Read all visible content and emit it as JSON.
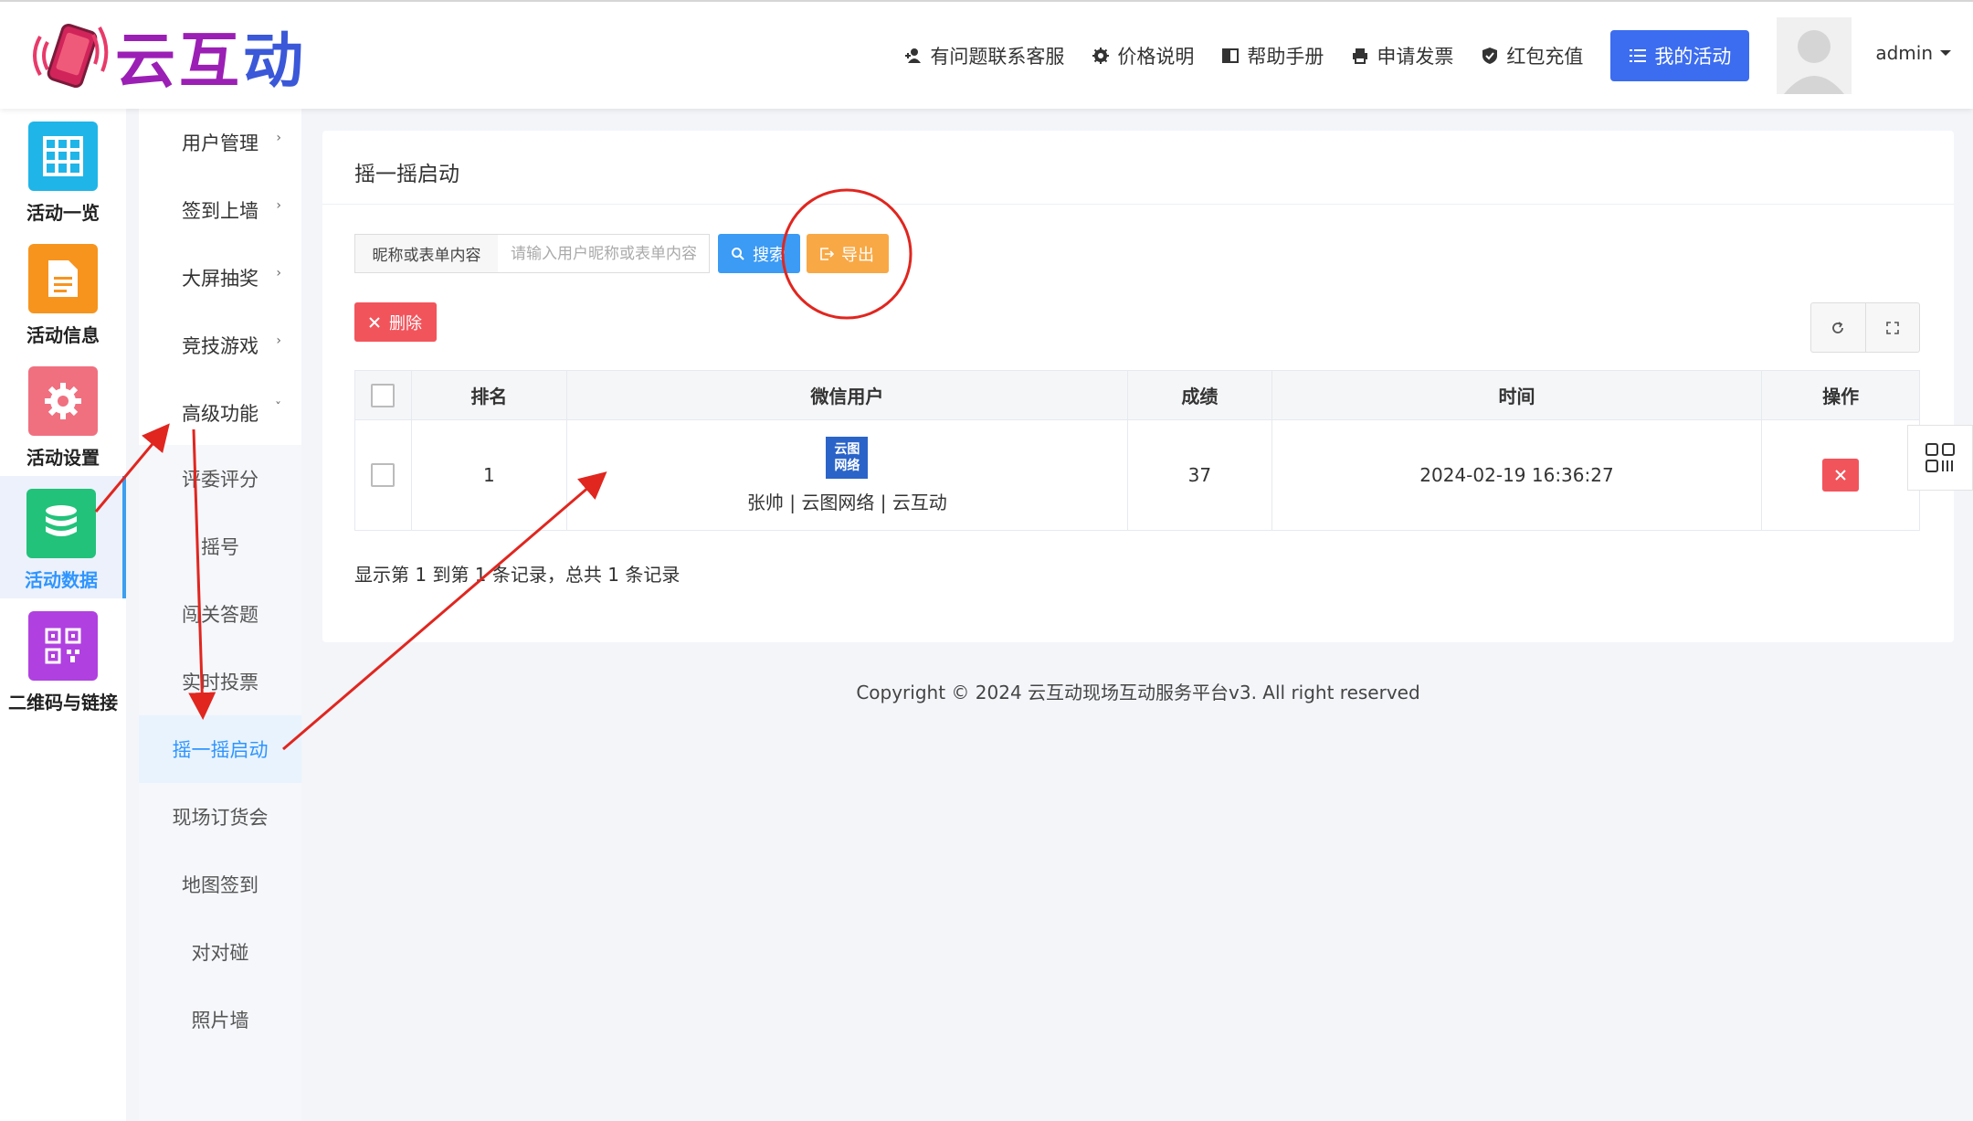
{
  "header": {
    "logo_text_main": "云互",
    "logo_text_accent": "动",
    "links": [
      "有问题联系客服",
      "价格说明",
      "帮助手册",
      "申请发票",
      "红包充值"
    ],
    "my_activity": "我的活动",
    "user": "admin"
  },
  "sidebar": {
    "items": [
      {
        "label": "活动一览",
        "icon": "grid-icon",
        "color": "#1fb5e8"
      },
      {
        "label": "活动信息",
        "icon": "document-icon",
        "color": "#f7941d"
      },
      {
        "label": "活动设置",
        "icon": "gear-icon",
        "color": "#f07080"
      },
      {
        "label": "活动数据",
        "icon": "database-icon",
        "color": "#22c27a"
      },
      {
        "label": "二维码与链接",
        "icon": "qrcode-icon",
        "color": "#b040e0"
      }
    ]
  },
  "submenu": {
    "items": [
      "用户管理",
      "签到上墙",
      "大屏抽奖",
      "竞技游戏",
      "高级功能"
    ],
    "children": [
      "评委评分",
      "摇号",
      "闯关答题",
      "实时投票",
      "摇一摇启动",
      "现场订货会",
      "地图签到",
      "对对碰",
      "照片墙"
    ]
  },
  "panel": {
    "title": "摇一摇启动",
    "search_label": "昵称或表单内容",
    "search_placeholder": "请输入用户昵称或表单内容",
    "search_btn": "搜索",
    "export_btn": "导出",
    "delete_btn": "删除",
    "table": {
      "headers": [
        "排名",
        "微信用户",
        "成绩",
        "时间",
        "操作"
      ],
      "rows": [
        {
          "rank": "1",
          "logo_top": "云图",
          "logo_bottom": "网络",
          "user": "张帅 | 云图网络 | 云互动",
          "score": "37",
          "time": "2024-02-19 16:36:27"
        }
      ]
    },
    "record_info": "显示第 1 到第 1 条记录，总共 1 条记录"
  },
  "footer": "Copyright © 2024 云互动现场互动服务平台v3. All right reserved",
  "colors": {
    "primary": "#3c6df0",
    "search": "#3b9bf5",
    "export": "#f8a844",
    "danger": "#f2545b",
    "annotation": "#e0261f"
  }
}
